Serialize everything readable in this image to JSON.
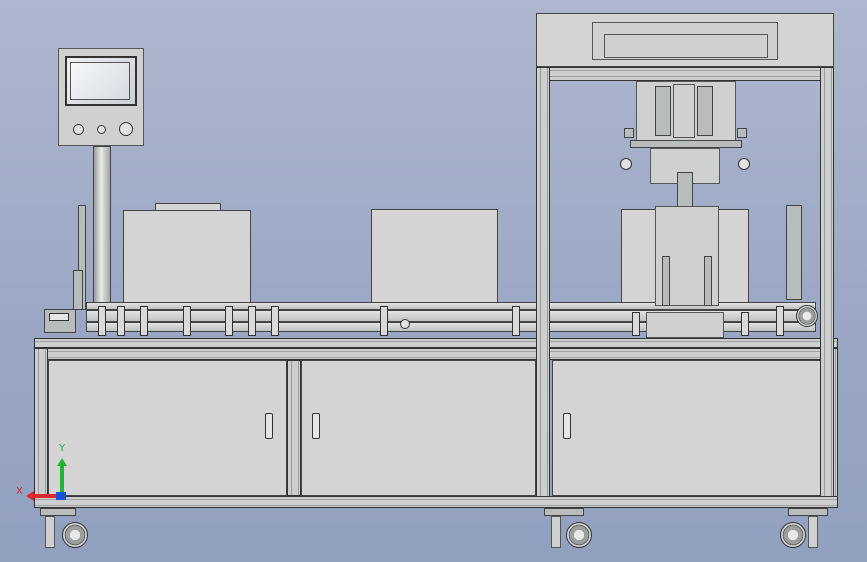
{
  "viewport": {
    "background_top": "#aeb7cf",
    "background_bottom": "#92a0c0"
  },
  "triad": {
    "x_label": "X",
    "y_label": "Y",
    "x_color": "#e0262a",
    "y_color": "#21b23a",
    "z_color": "#1f4fd8"
  },
  "machine": {
    "control_panel": {
      "screen_color": "#dfe4ea",
      "knob_count": 3
    },
    "cabinet_door_count": 3,
    "caster_count": 3,
    "guard_box_count": 2
  }
}
